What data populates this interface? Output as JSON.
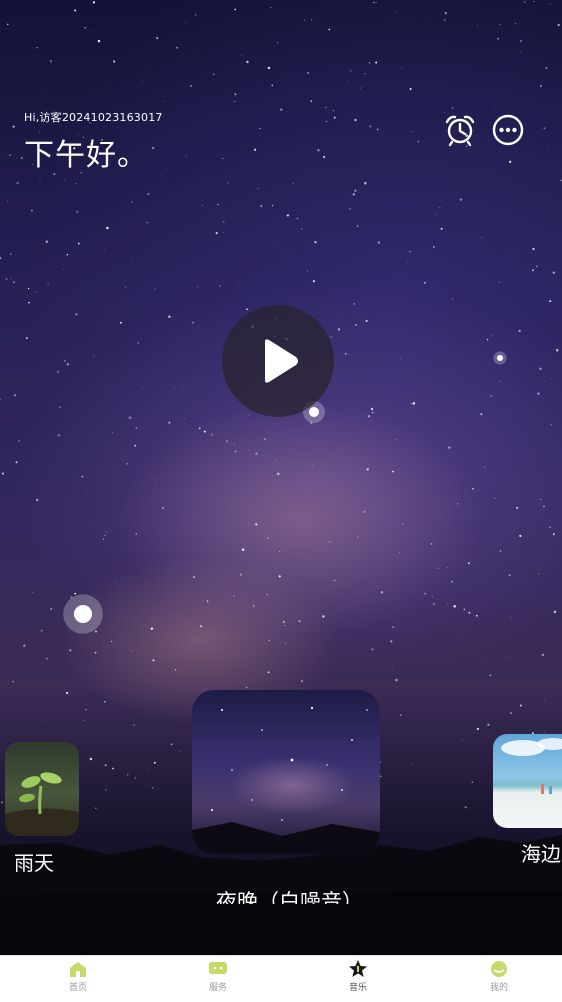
{
  "header": {
    "visitor_greeting": "Hi,访客20241023163017",
    "time_greeting": "下午好。"
  },
  "header_icons": [
    "alarm-clock-icon",
    "more-icon"
  ],
  "player": {
    "state_icon": "play-icon"
  },
  "scenes": [
    {
      "label": "雨天",
      "thumb": "rain-sprout-image"
    },
    {
      "label": "夜晚（白噪音）",
      "thumb": "night-sky-image"
    },
    {
      "label": "海边",
      "thumb": "seaside-image"
    }
  ],
  "tabbar": {
    "items": [
      {
        "label": "首页",
        "icon": "home-icon"
      },
      {
        "label": "服务",
        "icon": "chat-icon"
      },
      {
        "label": "音乐",
        "icon": "music-star-icon"
      },
      {
        "label": "我的",
        "icon": "profile-icon"
      }
    ],
    "active_index": 2
  },
  "colors": {
    "sky_top": "#141236",
    "sky_mid": "#34285e",
    "tab_icon_green": "#c8d86a",
    "tab_active_icon": "#1a1a1a"
  }
}
